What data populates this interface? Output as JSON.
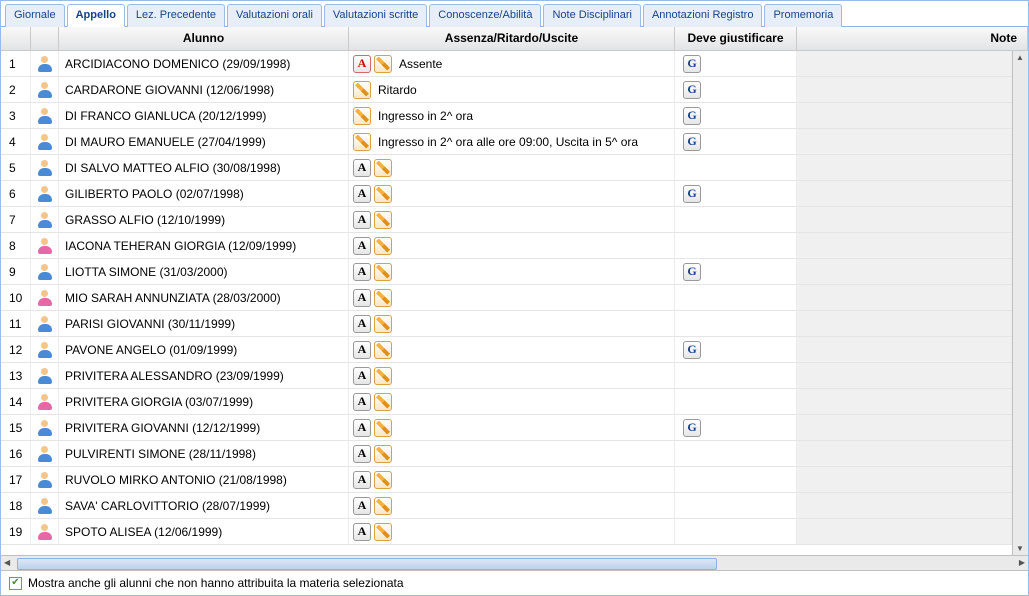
{
  "tabs": [
    {
      "label": "Giornale"
    },
    {
      "label": "Appello"
    },
    {
      "label": "Lez. Precedente"
    },
    {
      "label": "Valutazioni orali"
    },
    {
      "label": "Valutazioni scritte"
    },
    {
      "label": "Conoscenze/Abilità"
    },
    {
      "label": "Note Disciplinari"
    },
    {
      "label": "Annotazioni Registro"
    },
    {
      "label": "Promemoria"
    }
  ],
  "active_tab": 1,
  "columns": {
    "num": "",
    "icon": "",
    "name": "Alunno",
    "abs": "Assenza/Ritardo/Uscite",
    "giust": "Deve giustificare",
    "note": "Note"
  },
  "icon_labels": {
    "a": "A",
    "g": "G"
  },
  "rows": [
    {
      "n": "1",
      "gender": "m",
      "name": "ARCIDIACONO DOMENICO (29/09/1998)",
      "a_red": true,
      "show_a": false,
      "edit": true,
      "text": "Assente",
      "g": true
    },
    {
      "n": "2",
      "gender": "m",
      "name": "CARDARONE GIOVANNI (12/06/1998)",
      "a_red": false,
      "show_a": false,
      "edit": true,
      "text": "Ritardo",
      "g": true
    },
    {
      "n": "3",
      "gender": "m",
      "name": "DI FRANCO GIANLUCA (20/12/1999)",
      "a_red": false,
      "show_a": false,
      "edit": true,
      "text": "Ingresso in 2^ ora",
      "g": true
    },
    {
      "n": "4",
      "gender": "m",
      "name": "DI MAURO EMANUELE (27/04/1999)",
      "a_red": false,
      "show_a": false,
      "edit": true,
      "text": "Ingresso in 2^ ora alle ore 09:00, Uscita in 5^ ora",
      "g": true
    },
    {
      "n": "5",
      "gender": "m",
      "name": "DI SALVO MATTEO ALFIO (30/08/1998)",
      "a_red": false,
      "show_a": true,
      "edit": true,
      "text": "",
      "g": false
    },
    {
      "n": "6",
      "gender": "m",
      "name": "GILIBERTO PAOLO (02/07/1998)",
      "a_red": false,
      "show_a": true,
      "edit": true,
      "text": "",
      "g": true
    },
    {
      "n": "7",
      "gender": "m",
      "name": "GRASSO ALFIO (12/10/1999)",
      "a_red": false,
      "show_a": true,
      "edit": true,
      "text": "",
      "g": false
    },
    {
      "n": "8",
      "gender": "f",
      "name": "IACONA TEHERAN GIORGIA (12/09/1999)",
      "a_red": false,
      "show_a": true,
      "edit": true,
      "text": "",
      "g": false
    },
    {
      "n": "9",
      "gender": "m",
      "name": "LIOTTA SIMONE (31/03/2000)",
      "a_red": false,
      "show_a": true,
      "edit": true,
      "text": "",
      "g": true
    },
    {
      "n": "10",
      "gender": "f",
      "name": "MIO SARAH ANNUNZIATA (28/03/2000)",
      "a_red": false,
      "show_a": true,
      "edit": true,
      "text": "",
      "g": false
    },
    {
      "n": "11",
      "gender": "m",
      "name": "PARISI GIOVANNI (30/11/1999)",
      "a_red": false,
      "show_a": true,
      "edit": true,
      "text": "",
      "g": false
    },
    {
      "n": "12",
      "gender": "m",
      "name": "PAVONE ANGELO (01/09/1999)",
      "a_red": false,
      "show_a": true,
      "edit": true,
      "text": "",
      "g": true
    },
    {
      "n": "13",
      "gender": "m",
      "name": "PRIVITERA ALESSANDRO (23/09/1999)",
      "a_red": false,
      "show_a": true,
      "edit": true,
      "text": "",
      "g": false
    },
    {
      "n": "14",
      "gender": "f",
      "name": "PRIVITERA GIORGIA (03/07/1999)",
      "a_red": false,
      "show_a": true,
      "edit": true,
      "text": "",
      "g": false
    },
    {
      "n": "15",
      "gender": "m",
      "name": "PRIVITERA GIOVANNI (12/12/1999)",
      "a_red": false,
      "show_a": true,
      "edit": true,
      "text": "",
      "g": true
    },
    {
      "n": "16",
      "gender": "m",
      "name": "PULVIRENTI SIMONE (28/11/1998)",
      "a_red": false,
      "show_a": true,
      "edit": true,
      "text": "",
      "g": false
    },
    {
      "n": "17",
      "gender": "m",
      "name": "RUVOLO MIRKO ANTONIO (21/08/1998)",
      "a_red": false,
      "show_a": true,
      "edit": true,
      "text": "",
      "g": false
    },
    {
      "n": "18",
      "gender": "m",
      "name": "SAVA' CARLOVITTORIO (28/07/1999)",
      "a_red": false,
      "show_a": true,
      "edit": true,
      "text": "",
      "g": false
    },
    {
      "n": "19",
      "gender": "f",
      "name": "SPOTO ALISEA (12/06/1999)",
      "a_red": false,
      "show_a": true,
      "edit": true,
      "text": "",
      "g": false
    }
  ],
  "footer": {
    "show_all_label": "Mostra anche gli alunni che non hanno attribuita la materia selezionata",
    "show_all_checked": true
  }
}
